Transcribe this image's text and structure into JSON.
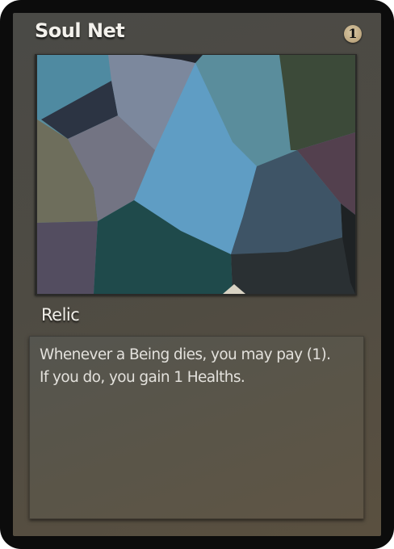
{
  "card": {
    "name": "Soul Net",
    "cost": "1",
    "type": "Relic",
    "rules_text": [
      "Whenever a Being dies, you may pay (1).",
      "If you do, you gain 1 Healths."
    ],
    "art_palette": [
      "#4f8aa1",
      "#7c889d",
      "#5a8d9c",
      "#3c4a39",
      "#2c3443",
      "#6e6e5c",
      "#737483",
      "#5f9dc4",
      "#3e5466",
      "#53404e",
      "#534d60",
      "#1f4a4b",
      "#2a3033"
    ]
  }
}
